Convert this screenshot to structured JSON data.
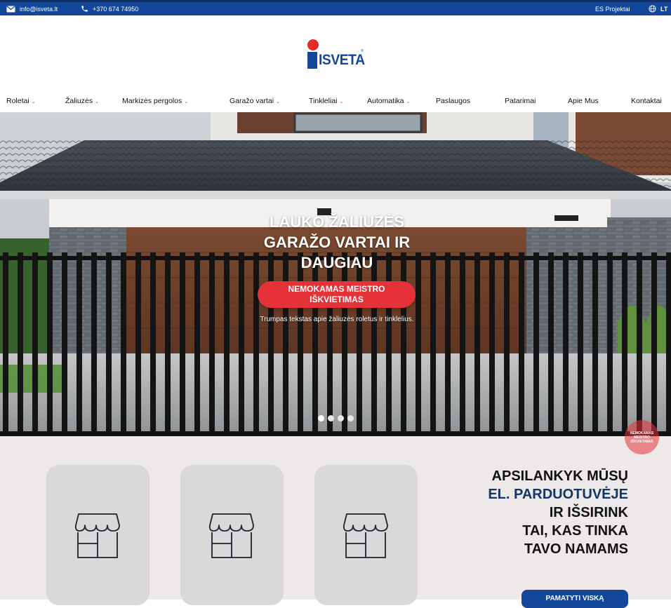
{
  "topbar": {
    "email": "info@isveta.lt",
    "phone": "+370 674 74950",
    "projects": "ES Projektai",
    "language": "LT"
  },
  "logo": {
    "text": "ISVETA",
    "reg": "®"
  },
  "nav": [
    {
      "label": "Roletai",
      "dropdown": true
    },
    {
      "label": "Žaliuzės",
      "dropdown": true
    },
    {
      "label": "Markizės pergolos",
      "dropdown": true
    },
    {
      "label": "Garažo vartai",
      "dropdown": true
    },
    {
      "label": "Tinkleliai",
      "dropdown": true
    },
    {
      "label": "Automatika",
      "dropdown": true
    },
    {
      "label": "Paslaugos",
      "dropdown": false
    },
    {
      "label": "Patarimai",
      "dropdown": false
    },
    {
      "label": "Apie Mus",
      "dropdown": false
    },
    {
      "label": "Kontaktai",
      "dropdown": false
    }
  ],
  "hero": {
    "title_line1": "LAUKO ŽALIUZĖS",
    "title_line2": "GARAŽO VARTAI IR",
    "title_line3": "DAUGIAU",
    "cta_line1": "NEMOKAMAS MEISTRO",
    "cta_line2": "IŠKVIETIMAS",
    "subtitle": "Trumpas tekstas apie žaliuzės roletus ir tinklelius.",
    "slide_count": 4,
    "active_slide": 1
  },
  "float_badge": {
    "line1": "NEMOKAMAS",
    "line2": "MEISTRO",
    "line3": "IŠKVIETIMAS"
  },
  "promo": {
    "line1": "APSILANKYK MŪSŲ",
    "line2": "EL. PARDUOTUVĖJE",
    "line3": "IR IŠSIRINK",
    "line4": "TAI, KAS TINKA",
    "line5": "TAVO NAMAMS",
    "button": "PAMATYTI VISKĄ"
  },
  "icons": {
    "email": "envelope-icon",
    "phone": "phone-icon",
    "language": "globe-icon",
    "card": "storefront-icon",
    "dropdown": "chevron-down-icon"
  },
  "colors": {
    "brand_blue": "#13479a",
    "brand_red": "#e53238",
    "dark_navy": "#14356b",
    "section_bg": "#ede9e8",
    "card_bg": "#d9d9da"
  }
}
